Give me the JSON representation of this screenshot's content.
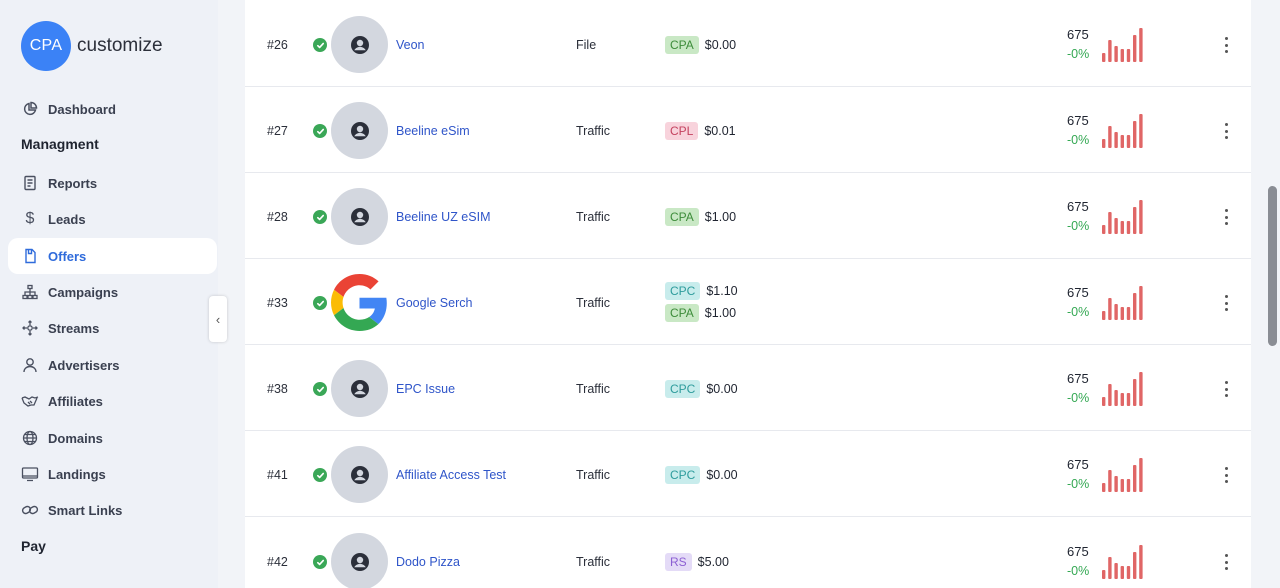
{
  "brand": {
    "logo_abbr": "CPA",
    "logo_text": "customize",
    "color": "#3b82f6"
  },
  "sidebar": {
    "dashboard": "Dashboard",
    "section_management": "Managment",
    "items": [
      {
        "label": "Reports",
        "icon": "reports-icon"
      },
      {
        "label": "Leads",
        "icon": "dollar-icon"
      },
      {
        "label": "Offers",
        "icon": "offers-icon",
        "active": true
      },
      {
        "label": "Campaigns",
        "icon": "sitemap-icon"
      },
      {
        "label": "Streams",
        "icon": "streams-icon"
      },
      {
        "label": "Advertisers",
        "icon": "user-icon"
      },
      {
        "label": "Affiliates",
        "icon": "handshake-icon"
      },
      {
        "label": "Domains",
        "icon": "globe-icon"
      },
      {
        "label": "Landings",
        "icon": "monitor-icon"
      },
      {
        "label": "Smart Links",
        "icon": "link-icon"
      }
    ],
    "section_pay": "Pay",
    "collapse_glyph": "‹"
  },
  "offers": [
    {
      "id": "#26",
      "name": "Veon",
      "type": "File",
      "logo": "avatar",
      "payouts": [
        {
          "model": "CPA",
          "amount": "$0.00"
        }
      ],
      "count": "675",
      "change": "-0%"
    },
    {
      "id": "#27",
      "name": "Beeline eSim",
      "type": "Traffic",
      "logo": "avatar",
      "payouts": [
        {
          "model": "CPL",
          "amount": "$0.01"
        }
      ],
      "count": "675",
      "change": "-0%"
    },
    {
      "id": "#28",
      "name": "Beeline UZ eSIM",
      "type": "Traffic",
      "logo": "avatar",
      "payouts": [
        {
          "model": "CPA",
          "amount": "$1.00"
        }
      ],
      "count": "675",
      "change": "-0%"
    },
    {
      "id": "#33",
      "name": "Google Serch",
      "type": "Traffic",
      "logo": "google",
      "payouts": [
        {
          "model": "CPC",
          "amount": "$1.10"
        },
        {
          "model": "CPA",
          "amount": "$1.00"
        }
      ],
      "count": "675",
      "change": "-0%"
    },
    {
      "id": "#38",
      "name": "EPC Issue",
      "type": "Traffic",
      "logo": "avatar",
      "payouts": [
        {
          "model": "CPC",
          "amount": "$0.00"
        }
      ],
      "count": "675",
      "change": "-0%"
    },
    {
      "id": "#41",
      "name": "Affiliate Access Test",
      "type": "Traffic",
      "logo": "avatar",
      "payouts": [
        {
          "model": "CPC",
          "amount": "$0.00"
        }
      ],
      "count": "675",
      "change": "-0%"
    },
    {
      "id": "#42",
      "name": "Dodo Pizza",
      "type": "Traffic",
      "logo": "avatar",
      "payouts": [
        {
          "model": "RS",
          "amount": "$5.00"
        }
      ],
      "count": "675",
      "change": "-0%"
    }
  ],
  "sparkline": {
    "values": [
      5,
      12,
      9,
      7,
      7,
      15,
      19
    ],
    "max": 20,
    "color": "#e06666"
  },
  "colors": {
    "status_ok": "#3aa757",
    "positive": "#34a853",
    "link": "#2f55c9"
  }
}
